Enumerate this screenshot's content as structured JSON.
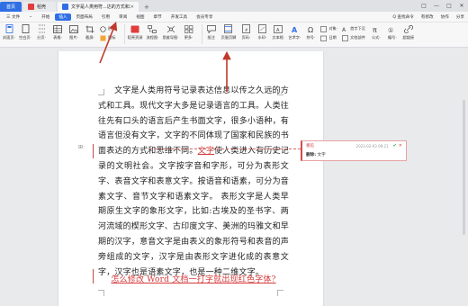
{
  "titlebar": {
    "tabs": [
      {
        "label": "首页",
        "color": "#2f6fe4"
      },
      {
        "label": "稻壳",
        "color": "#e23c3c"
      },
      {
        "label": "文字是人类用符...达的方式和工具",
        "color": "#2f6fe4"
      }
    ],
    "add_tab": "+",
    "window_controls": [
      "□",
      "—",
      "□",
      "✕"
    ]
  },
  "menubar": {
    "items": [
      "三 文件",
      "⌄",
      "开始",
      "插入",
      "页面布局",
      "引用",
      "审阅",
      "视图",
      "章节",
      "开发工具",
      "会员专享"
    ],
    "active": "插入",
    "right": [
      "Q 查找命令",
      "有修改",
      "协作",
      "分享"
    ]
  },
  "ribbon": {
    "groups": [
      {
        "label": "封面页·",
        "icon": "cover-page-icon"
      },
      {
        "label": "空白页·",
        "icon": "blank-page-icon"
      },
      {
        "label": "分页·",
        "icon": "page-break-icon"
      },
      {
        "label": "表格·",
        "icon": "table-icon"
      },
      {
        "label": "图片·",
        "icon": "picture-icon"
      },
      {
        "label": "截屏·",
        "icon": "screenshot-icon"
      }
    ],
    "small_group": [
      {
        "label": "形状·",
        "icon": "shape-icon"
      },
      {
        "label": "图标",
        "icon": "gallery-icon"
      }
    ],
    "groups2": [
      {
        "label": "稻壳资源",
        "icon": "resource-icon"
      },
      {
        "label": "流程图·",
        "icon": "flowchart-icon"
      },
      {
        "label": "思维导图·",
        "icon": "mindmap-icon"
      },
      {
        "label": "更多·",
        "icon": "more-icon"
      },
      {
        "label": "批注",
        "icon": "comment-icon"
      },
      {
        "label": "页眉页脚",
        "icon": "header-footer-icon"
      },
      {
        "label": "页码·",
        "icon": "page-number-icon"
      },
      {
        "label": "水印·",
        "icon": "watermark-icon"
      },
      {
        "label": "文本框·",
        "icon": "textbox-icon"
      },
      {
        "label": "艺术字·",
        "icon": "wordart-icon"
      },
      {
        "label": "符号·",
        "icon": "symbol-icon"
      }
    ],
    "small_group2": [
      {
        "label": "对象·",
        "icon": "object-icon"
      },
      {
        "label": "日期",
        "icon": "date-icon"
      }
    ],
    "small_group3": [
      {
        "label": "首字下沉",
        "icon": "dropcap-icon"
      },
      {
        "label": "文档部件",
        "icon": "docparts-icon"
      }
    ],
    "groups3": [
      {
        "label": "公式·",
        "icon": "formula-icon"
      },
      {
        "label": "编号·",
        "icon": "numbering-icon"
      },
      {
        "label": "超链接",
        "icon": "link-icon"
      }
    ]
  },
  "document": {
    "paragraph_before": "文字是人类用符号记录表达信息以传之久远的方式和工具。现代文字大多是记录语言的工具。人类往往先有口头的语言后产生书面文字，很多小语种，有语言但没有文字，文字的不同体现了国家和民族的书面表达的方式和思维不同。",
    "inserted_text": "文字",
    "paragraph_after": "使人类进入有历史记录的文明社会。文字按字音和字形，可分为表形文字、表音文字和表意文字。按语音和语素，可分为音素文字、音节文字和语素文字。 表形文字是人类早期原生文字的象形文字，比如:古埃及的圣书字、两河流域的楔形文字、古印度文字、美洲的玛雅文和早期的汉字，意音文字是由表义的象形符号和表音的声旁组成的文字，汉字是由表形文字进化成的表意文字，汉字也是语素文字，也是一种二维文字。",
    "caption": "怎么修改 Word 文档一打字就出现红色字体?"
  },
  "comment": {
    "author": "番茄",
    "time": "2023-02-03 09:21",
    "accept": "✔",
    "reject": "✕",
    "content_label": "删除:",
    "content_value": "文字"
  },
  "colors": {
    "accent": "#2f6fe4",
    "track_change": "#d43a3a",
    "arrow": "#c0392b"
  }
}
